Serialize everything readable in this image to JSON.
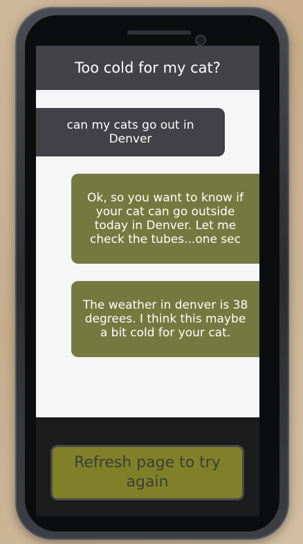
{
  "app": {
    "title": "Too cold for my cat?"
  },
  "messages": [
    {
      "sender": "user",
      "text": "can my cats go out in Denver"
    },
    {
      "sender": "bot",
      "text": "Ok, so you want to know if your cat can go outside today in Denver. Let me check the tubes...one sec"
    },
    {
      "sender": "bot",
      "text": "The weather in denver is 38 degrees. I think this maybe a bit cold for your cat."
    }
  ],
  "footer": {
    "refresh_label": "Refresh page to try again"
  },
  "colors": {
    "header": "#434247",
    "user_bubble": "#424147",
    "bot_bubble": "#74793f",
    "button": "#808028",
    "footer": "#1c1c1d"
  }
}
